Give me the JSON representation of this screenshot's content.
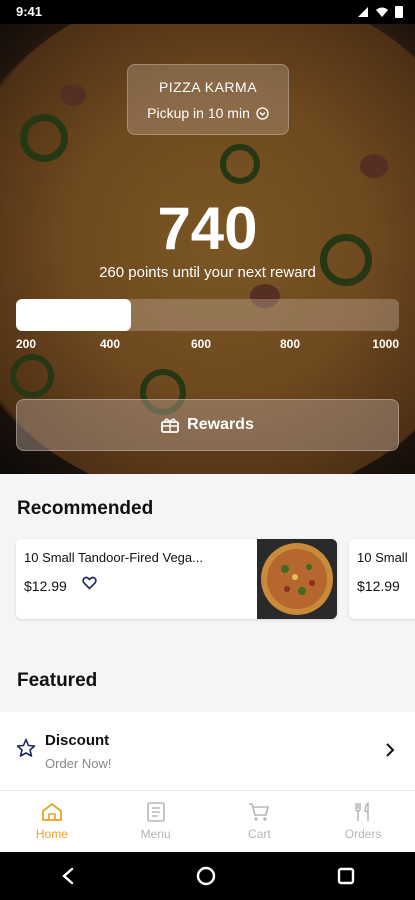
{
  "status_bar": {
    "time": "9:41"
  },
  "hero": {
    "store_name": "PIZZA KARMA",
    "pickup_text": "Pickup in 10 min",
    "points": "740",
    "points_message": "260 points until your next reward",
    "progress_fraction": 0.3,
    "ticks": [
      "200",
      "400",
      "600",
      "800",
      "1000"
    ],
    "rewards_label": "Rewards"
  },
  "recommended": {
    "title": "Recommended",
    "items": [
      {
        "title": "10 Small Tandoor-Fired Vega...",
        "price": "$12.99"
      },
      {
        "title": "10 Small",
        "price": "$12.99"
      }
    ]
  },
  "featured": {
    "title": "Featured",
    "item": {
      "title": "Discount",
      "subtitle": "Order Now!"
    }
  },
  "tabs": [
    {
      "label": "Home",
      "icon": "home-icon",
      "active": true
    },
    {
      "label": "Menu",
      "icon": "menu-icon",
      "active": false
    },
    {
      "label": "Cart",
      "icon": "cart-icon",
      "active": false
    },
    {
      "label": "Orders",
      "icon": "orders-icon",
      "active": false
    }
  ],
  "colors": {
    "accent": "#e8a328",
    "inactive_tab": "#b5b5b5",
    "background": "#f5f5f7"
  }
}
